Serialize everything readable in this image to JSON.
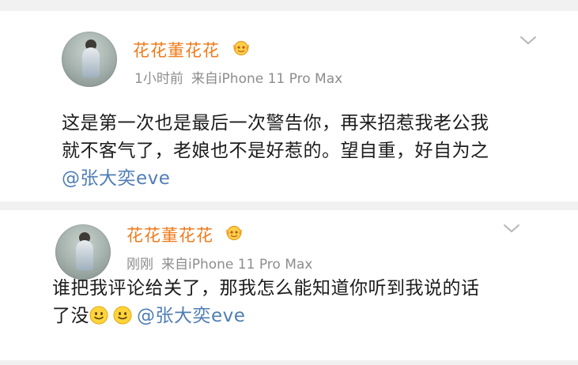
{
  "posts": [
    {
      "username": "花花董花花",
      "time": "1小时前",
      "source": "来自iPhone 11 Pro Max",
      "line1": "这是第一次也是最后一次警告你，再来招惹我老公我",
      "line2": "就不客气了，老娘也不是好惹的。望自重，好自为之",
      "mention": "@张大奕eve"
    },
    {
      "username": "花花董花花",
      "time": "刚刚",
      "source": "来自iPhone 11 Pro Max",
      "line1": "谁把我评论给关了，那我怎么能知道你听到我说的话",
      "line2_prefix": "了没",
      "mention": "@张大奕eve"
    }
  ],
  "colors": {
    "username": "#f07a1a",
    "meta": "#8d8d8d",
    "text": "#1c1c1c",
    "mention": "#4f7db5"
  },
  "icons": {
    "badge": "vip-crown-icon",
    "menu": "chevron-down-icon",
    "emoji": "smile-emoji-icon"
  }
}
